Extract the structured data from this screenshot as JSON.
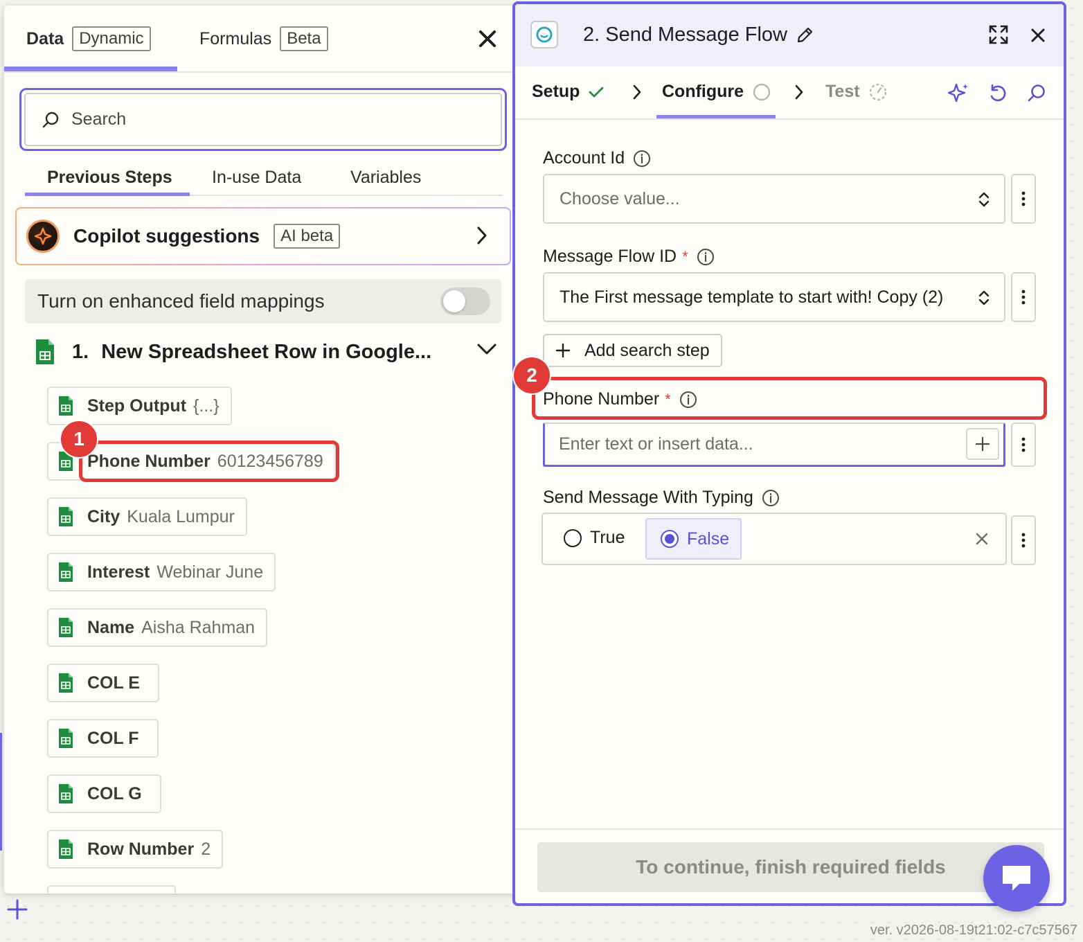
{
  "left_panel": {
    "tabs": [
      {
        "label": "Data",
        "badge": "Dynamic"
      },
      {
        "label": "Formulas",
        "badge": "Beta"
      }
    ],
    "search_placeholder": "Search",
    "sub_tabs": [
      "Previous Steps",
      "In-use Data",
      "Variables"
    ],
    "copilot": {
      "title": "Copilot suggestions",
      "badge": "AI beta"
    },
    "enhanced_mappings": {
      "label": "Turn on enhanced field mappings",
      "enabled": false
    },
    "step": {
      "number": "1.",
      "title": "New Spreadsheet Row in Google..."
    },
    "fields": [
      {
        "label": "Step Output",
        "value": "{...}"
      },
      {
        "label": "Phone Number",
        "value": "60123456789"
      },
      {
        "label": "City",
        "value": "Kuala Lumpur"
      },
      {
        "label": "Interest",
        "value": "Webinar June"
      },
      {
        "label": "Name",
        "value": "Aisha Rahman"
      },
      {
        "label": "COL E",
        "value": ""
      },
      {
        "label": "COL F",
        "value": ""
      },
      {
        "label": "COL G",
        "value": ""
      },
      {
        "label": "Row Number",
        "value": "2"
      }
    ]
  },
  "right_panel": {
    "title": "2. Send Message Flow",
    "stages": [
      {
        "label": "Setup",
        "status": "complete"
      },
      {
        "label": "Configure",
        "status": "in-progress"
      },
      {
        "label": "Test",
        "status": "pending"
      }
    ],
    "fields": {
      "account_id": {
        "label": "Account Id",
        "placeholder": "Choose value..."
      },
      "message_flow_id": {
        "label": "Message Flow ID",
        "required": "*",
        "value": "The First message template to start with! Copy (2)"
      },
      "add_search_step": "Add search step",
      "phone_number": {
        "label": "Phone Number",
        "required": "*",
        "placeholder": "Enter text or insert data..."
      },
      "send_with_typing": {
        "label": "Send Message With Typing",
        "options": [
          "True",
          "False"
        ],
        "selected": "False"
      }
    },
    "continue_button": "To continue, finish required fields"
  },
  "annotations": {
    "marker_1": "1",
    "marker_2": "2"
  },
  "version": "ver. v2026-08-19t21:02-c7c57567",
  "colors": {
    "accent": "#6c63e4",
    "highlight": "#e23a37",
    "sheets_green": "#1e8e3e"
  }
}
